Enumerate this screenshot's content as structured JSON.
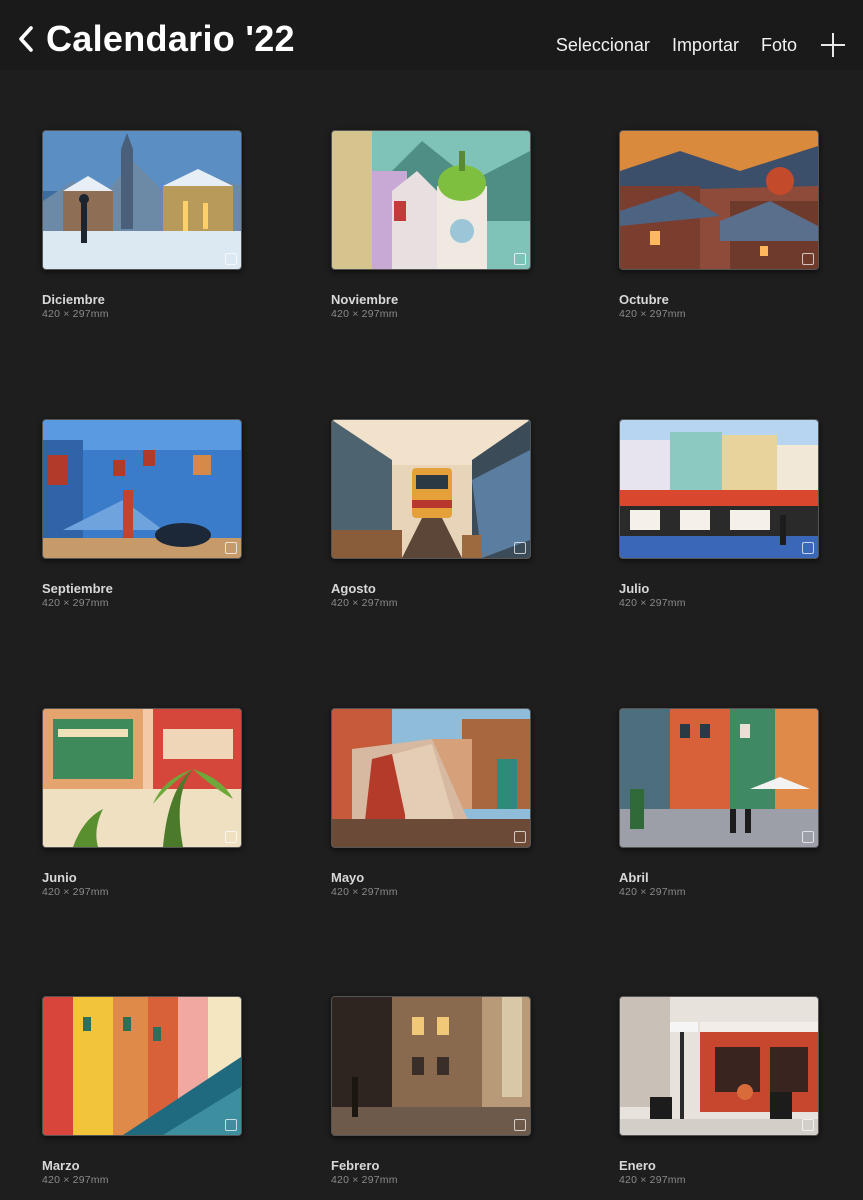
{
  "header": {
    "title": "Calendario '22",
    "actions": {
      "select": "Seleccionar",
      "import": "Importar",
      "photo": "Foto"
    }
  },
  "gallery": {
    "items": [
      {
        "name": "Diciembre",
        "size": "420 × 297mm"
      },
      {
        "name": "Noviembre",
        "size": "420 × 297mm"
      },
      {
        "name": "Octubre",
        "size": "420 × 297mm"
      },
      {
        "name": "Septiembre",
        "size": "420 × 297mm"
      },
      {
        "name": "Agosto",
        "size": "420 × 297mm"
      },
      {
        "name": "Julio",
        "size": "420 × 297mm"
      },
      {
        "name": "Junio",
        "size": "420 × 297mm"
      },
      {
        "name": "Mayo",
        "size": "420 × 297mm"
      },
      {
        "name": "Abril",
        "size": "420 × 297mm"
      },
      {
        "name": "Marzo",
        "size": "420 × 297mm"
      },
      {
        "name": "Febrero",
        "size": "420 × 297mm"
      },
      {
        "name": "Enero",
        "size": "420 × 297mm"
      }
    ]
  },
  "icons": {
    "back": "chevron-left-icon",
    "add": "plus-icon"
  }
}
